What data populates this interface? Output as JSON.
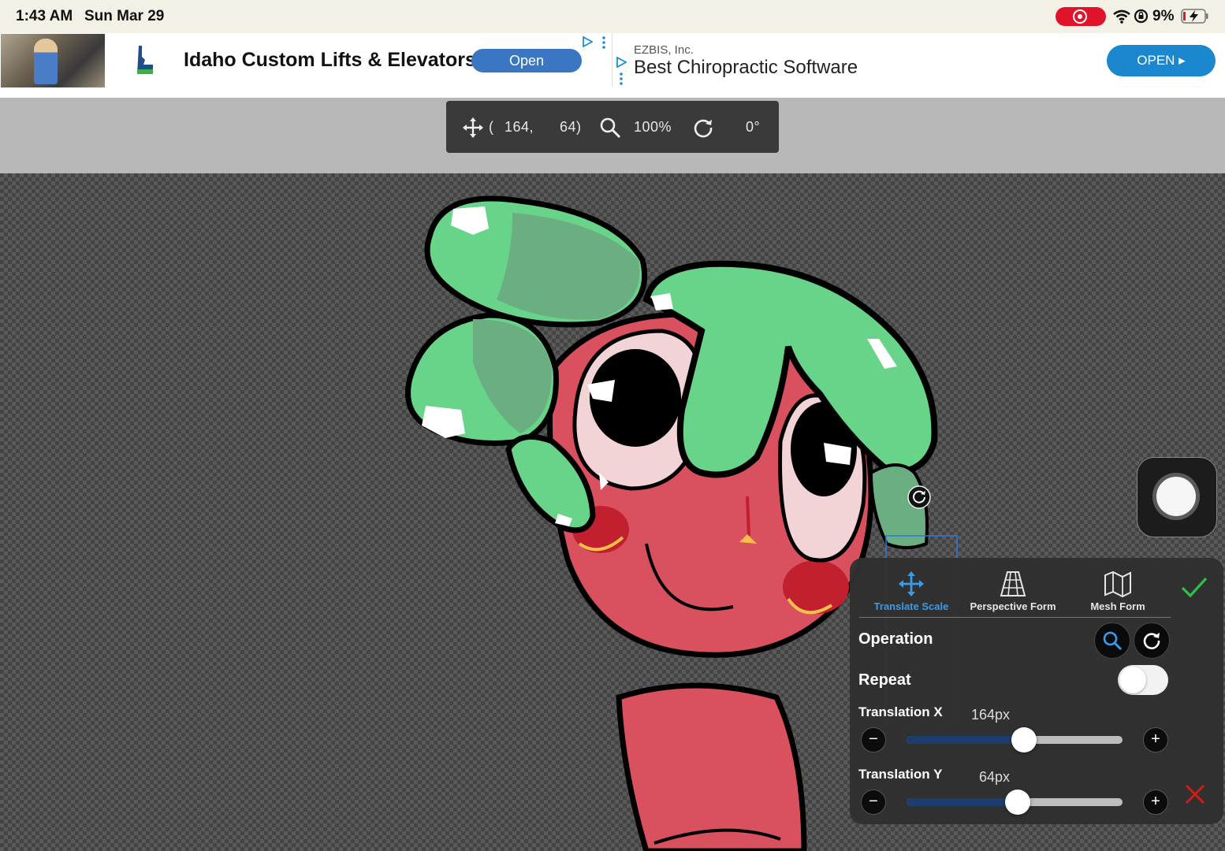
{
  "status": {
    "time": "1:43 AM",
    "date": "Sun Mar 29",
    "battery": "9%"
  },
  "ads": {
    "ad1": {
      "title": "Idaho Custom Lifts & Elevators",
      "button": "Open"
    },
    "ad2": {
      "sponsor": "EZBIS, Inc.",
      "title": "Best Chiropractic Software",
      "button": "OPEN ▸"
    }
  },
  "info_toolbar": {
    "paren_open": "(",
    "x": "164,",
    "y": "64)",
    "zoom": "100%",
    "angle": "0°"
  },
  "panel": {
    "tabs": [
      {
        "label": "Translate Scale",
        "icon": "move-arrows-icon",
        "active": true
      },
      {
        "label": "Perspective Form",
        "icon": "perspective-grid-icon",
        "active": false
      },
      {
        "label": "Mesh Form",
        "icon": "mesh-map-icon",
        "active": false
      }
    ],
    "operation_label": "Operation",
    "repeat_label": "Repeat",
    "repeat_on": false,
    "translation_x": {
      "label": "Translation X",
      "value": "164px",
      "fraction": 0.545
    },
    "translation_y": {
      "label": "Translation Y",
      "value": "64px",
      "fraction": 0.515
    }
  },
  "colors": {
    "accent_blue": "#3a9be8",
    "confirm_green": "#2fbf4a",
    "cancel_red": "#d11a1a",
    "hair_green": "#67d48a",
    "skin_red": "#d9505e"
  }
}
